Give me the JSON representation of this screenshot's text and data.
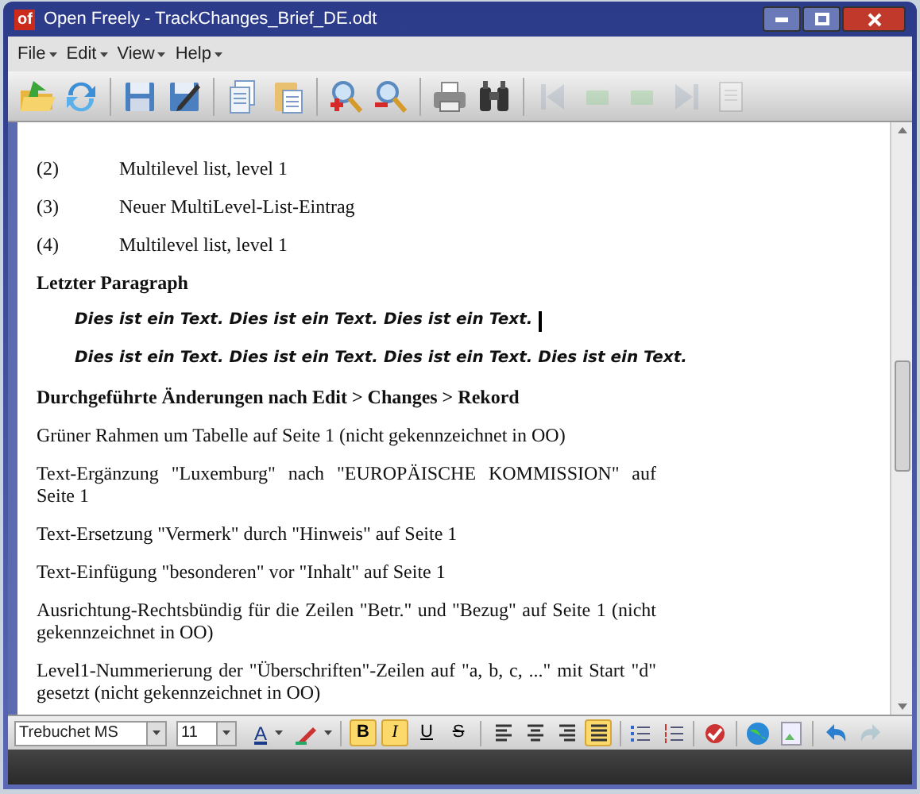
{
  "window": {
    "title": "Open Freely - TrackChanges_Brief_DE.odt",
    "logo": "of"
  },
  "menu": [
    {
      "label": "File"
    },
    {
      "label": "Edit"
    },
    {
      "label": "View"
    },
    {
      "label": "Help"
    }
  ],
  "toolbar": [
    {
      "kind": "open",
      "disabled": false
    },
    {
      "kind": "refresh",
      "disabled": false
    },
    {
      "kind": "save",
      "disabled": false
    },
    {
      "kind": "save-as",
      "disabled": false
    },
    {
      "kind": "copy",
      "disabled": false
    },
    {
      "kind": "paste",
      "disabled": false
    },
    {
      "kind": "zoom-in",
      "disabled": false
    },
    {
      "kind": "zoom-out",
      "disabled": false
    },
    {
      "kind": "print",
      "disabled": false
    },
    {
      "kind": "find",
      "disabled": false
    },
    {
      "kind": "first",
      "disabled": true
    },
    {
      "kind": "prev",
      "disabled": true
    },
    {
      "kind": "next",
      "disabled": true
    },
    {
      "kind": "last",
      "disabled": true
    },
    {
      "kind": "page",
      "disabled": true
    }
  ],
  "document": [
    {
      "kind": "numbered",
      "number": "(2)",
      "text": "Multilevel list, level 1"
    },
    {
      "kind": "numbered",
      "number": "(3)",
      "text": "Neuer MultiLevel-List-Eintrag"
    },
    {
      "kind": "numbered",
      "number": "(4)",
      "text": "Multilevel list, level 1"
    },
    {
      "kind": "heading",
      "text": "Letzter Paragraph"
    },
    {
      "kind": "quote",
      "text": "Dies ist ein Text. Dies ist ein Text. Dies ist ein Text.",
      "cursor": true
    },
    {
      "kind": "quote",
      "text": "Dies ist ein Text. Dies ist ein Text. Dies ist ein Text. Dies ist ein Text.",
      "cursor": false
    },
    {
      "kind": "heading",
      "text": "Durchgeführte Änderungen nach Edit > Changes > Rekord"
    },
    {
      "kind": "para",
      "text": "Grüner Rahmen um Tabelle auf Seite 1 (nicht gekennzeichnet in OO)"
    },
    {
      "kind": "para",
      "text": "Text-Ergänzung \"Luxemburg\" nach \"EUROPÄISCHE KOMMISSION\" auf Seite 1"
    },
    {
      "kind": "para",
      "text": "Text-Ersetzung \"Vermerk\" durch \"Hinweis\" auf Seite 1"
    },
    {
      "kind": "para",
      "text": "Text-Einfügung \"besonderen\" vor \"Inhalt\" auf Seite 1"
    },
    {
      "kind": "para",
      "text": "Ausrichtung-Rechtsbündig für die Zeilen \"Betr.\" und \"Bezug\" auf Seite 1 (nicht gekennzeichnet in OO)"
    },
    {
      "kind": "para",
      "text": "Level1-Nummerierung der \"Überschriften\"-Zeilen auf \"a, b, c, ...\" mit Start \"d\" gesetzt (nicht gekennzeichnet in OO)"
    }
  ],
  "format_bar": {
    "font": "Trebuchet MS",
    "size": "11",
    "font_color_label": "A",
    "styles": [
      {
        "kind": "bold",
        "label": "B",
        "selected": true
      },
      {
        "kind": "italic",
        "label": "I",
        "selected": true
      },
      {
        "kind": "underline",
        "label": "U",
        "selected": false
      },
      {
        "kind": "strike",
        "label": "S",
        "selected": false
      }
    ],
    "align": [
      {
        "kind": "left",
        "selected": false
      },
      {
        "kind": "center",
        "selected": false
      },
      {
        "kind": "right",
        "selected": false
      },
      {
        "kind": "justify",
        "selected": true
      }
    ]
  }
}
